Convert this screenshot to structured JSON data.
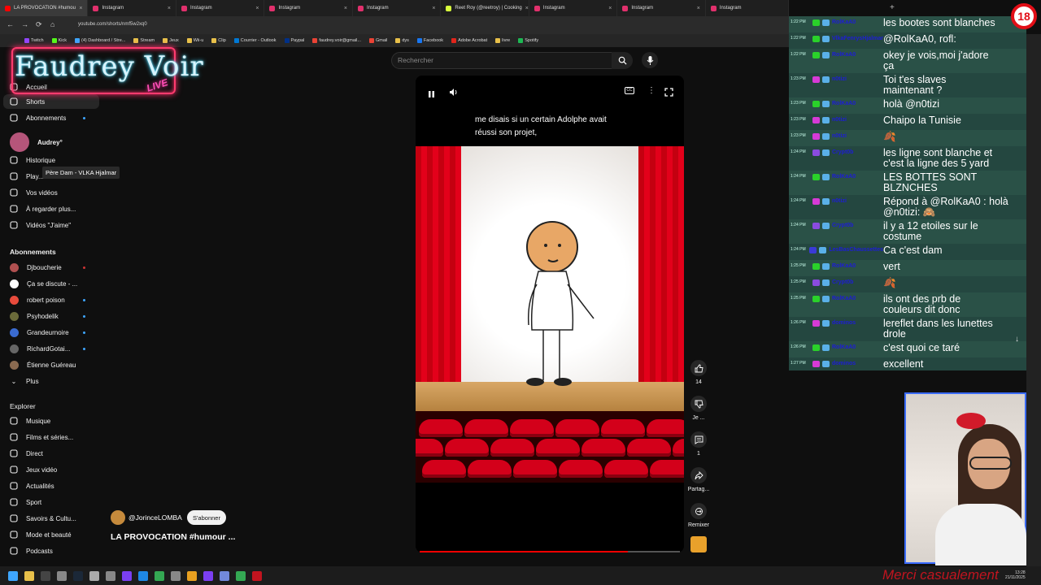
{
  "browser": {
    "tabs": [
      {
        "label": "LA PROVOCATION #humou",
        "color": "#ff0000",
        "active": true
      },
      {
        "label": "Instagram",
        "color": "#e1306c",
        "active": false
      },
      {
        "label": "Instagram",
        "color": "#e1306c",
        "active": false
      },
      {
        "label": "Instagram",
        "color": "#e1306c",
        "active": false
      },
      {
        "label": "Instagram",
        "color": "#e1306c",
        "active": false
      },
      {
        "label": "Reet Roy (@reetroy) | Cooking",
        "color": "#d8ff3c",
        "active": false
      },
      {
        "label": "Instagram",
        "color": "#e1306c",
        "active": false
      },
      {
        "label": "Instagram",
        "color": "#e1306c",
        "active": false
      }
    ],
    "tab_overflow_label": "Instagram",
    "new_tab": "+",
    "url": "youtube.com/shorts/nmf5w2xq0",
    "bookmarks": [
      "Twitch",
      "Kick",
      "(4) Dashboard / Stre...",
      "Stream",
      "Jeux",
      "Wii-u",
      "Clip",
      "Courrier - Outlook",
      "Paypal",
      "faudrey.voir@gmail...",
      "Gmail",
      "dys",
      "Facebook",
      "Adobe Acrobat",
      "livre",
      "Spotify"
    ]
  },
  "overlay": {
    "logo_text": "Faudrey Voir",
    "logo_live": "LIVE",
    "age_badge": "18"
  },
  "sidebar": {
    "main": [
      {
        "label": "Accueil",
        "icon": "home-icon"
      },
      {
        "label": "Shorts",
        "icon": "shorts-icon"
      },
      {
        "label": "Abonnements",
        "icon": "subscriptions-icon"
      }
    ],
    "you_label": "Audrey°",
    "you_items": [
      {
        "label": "Historique",
        "icon": "history-icon"
      },
      {
        "label": "Play...",
        "icon": "playlist-icon"
      },
      {
        "label": "Vos vidéos",
        "icon": "your-videos-icon"
      },
      {
        "label": "À regarder plus...",
        "icon": "watch-later-icon"
      },
      {
        "label": "Vidéos \"J'aime\"",
        "icon": "liked-icon"
      }
    ],
    "tooltip": "Père Dam - VLKA Hjalmar",
    "subs_header": "Abonnements",
    "subs": [
      {
        "label": "Djboucherie",
        "color": "#b05050",
        "live": true
      },
      {
        "label": "Ça se discute - ...",
        "color": "#ffffff",
        "live": false
      },
      {
        "label": "robert poison",
        "color": "#e84b3c",
        "live": true
      },
      {
        "label": "Psyhodelik",
        "color": "#6b6b3a",
        "live": true
      },
      {
        "label": "Grandeurnoire",
        "color": "#3a6bd0",
        "live": true
      },
      {
        "label": "RichardGotai...",
        "color": "#666666",
        "live": true
      },
      {
        "label": "Étienne Guéreau",
        "color": "#8a6a50",
        "live": false
      }
    ],
    "more": "Plus",
    "explore_header": "Explorer",
    "explore": [
      {
        "label": "Musique",
        "icon": "music-icon"
      },
      {
        "label": "Films et séries...",
        "icon": "film-icon"
      },
      {
        "label": "Direct",
        "icon": "live-icon"
      },
      {
        "label": "Jeux vidéo",
        "icon": "gaming-icon"
      },
      {
        "label": "Actualités",
        "icon": "news-icon"
      },
      {
        "label": "Sport",
        "icon": "sport-icon"
      },
      {
        "label": "Savoirs & Cultu...",
        "icon": "learning-icon"
      },
      {
        "label": "Mode et beauté",
        "icon": "fashion-icon"
      },
      {
        "label": "Podcasts",
        "icon": "podcast-icon"
      }
    ]
  },
  "search": {
    "placeholder": "Rechercher"
  },
  "video": {
    "caption": "me disais si un certain Adolphe avait réussi son projet,",
    "progress": 0.8,
    "channel": "@JorinceLOMBA",
    "subscribe": "S'abonner",
    "title": "LA PROVOCATION #humour ..."
  },
  "actions": {
    "likes": "14",
    "dislike": "Je ...",
    "comments": "1",
    "share": "Partag...",
    "remix": "Remixer"
  },
  "chat": {
    "messages": [
      {
        "time": "1:22 PM",
        "user": "RolKaA0",
        "text": "les bootes sont blanches",
        "badge": "#2ad12a"
      },
      {
        "time": "1:22 PM",
        "user": "VlkaFenrysHjalmar",
        "text": "@RolKaA0, rofl:",
        "badge": "#2ad12a"
      },
      {
        "time": "1:22 PM",
        "user": "RolKaA0",
        "text": "okey je vois,moi j'adore\nça",
        "badge": "#2ad12a"
      },
      {
        "time": "1:23 PM",
        "user": "n0tizi",
        "text": "Toi t'es slaves\nmaintenant ?",
        "badge": "#d63ad6"
      },
      {
        "time": "1:23 PM",
        "user": "RolKaA0",
        "text": "holà @n0tizi",
        "badge": "#2ad12a"
      },
      {
        "time": "1:23 PM",
        "user": "n0tizi",
        "text": "Chaipo la Tunisie",
        "badge": "#d63ad6"
      },
      {
        "time": "1:23 PM",
        "user": "n0tizi",
        "text": "🍂",
        "badge": "#d63ad6"
      },
      {
        "time": "1:24 PM",
        "user": "Crypt0b",
        "text": "les ligne sont blanche et\nc'est la ligne des 5 yard",
        "badge": "#8a4be0"
      },
      {
        "time": "1:24 PM",
        "user": "RolKaA0",
        "text": "LES BOTTES SONT\nBLZNCHES",
        "badge": "#2ad12a"
      },
      {
        "time": "1:24 PM",
        "user": "n0tizi",
        "text": "Répond à @RolKaA0 : holà\n@n0tizi: 🙈",
        "badge": "#d63ad6"
      },
      {
        "time": "1:24 PM",
        "user": "Crypt0b",
        "text": "il y a 12 etoiles sur le\ncostume",
        "badge": "#8a4be0"
      },
      {
        "time": "1:24 PM",
        "user": "LesBasChaussettes",
        "text": "Ca c'est dam",
        "badge": "#3a3ad6"
      },
      {
        "time": "1:25 PM",
        "user": "RolKaA0",
        "text": "vert",
        "badge": "#2ad12a"
      },
      {
        "time": "1:25 PM",
        "user": "Crypt0b",
        "text": "🍂",
        "badge": "#8a4be0"
      },
      {
        "time": "1:25 PM",
        "user": "RolKaA0",
        "text": "ils ont des prb de\ncouleurs dit donc",
        "badge": "#2ad12a"
      },
      {
        "time": "1:26 PM",
        "user": "dominos",
        "text": "lereflet dans les lunettes\ndrole",
        "badge": "#d63ad6"
      },
      {
        "time": "1:26 PM",
        "user": "RolKaA0",
        "text": "c'est quoi ce taré",
        "badge": "#2ad12a"
      },
      {
        "time": "1:27 PM",
        "user": "dominos",
        "text": "excellent",
        "badge": "#d63ad6"
      }
    ]
  },
  "overlay_bottom": "Merci casualement",
  "clock": {
    "time": "13:28",
    "date": "21/11/2025"
  }
}
